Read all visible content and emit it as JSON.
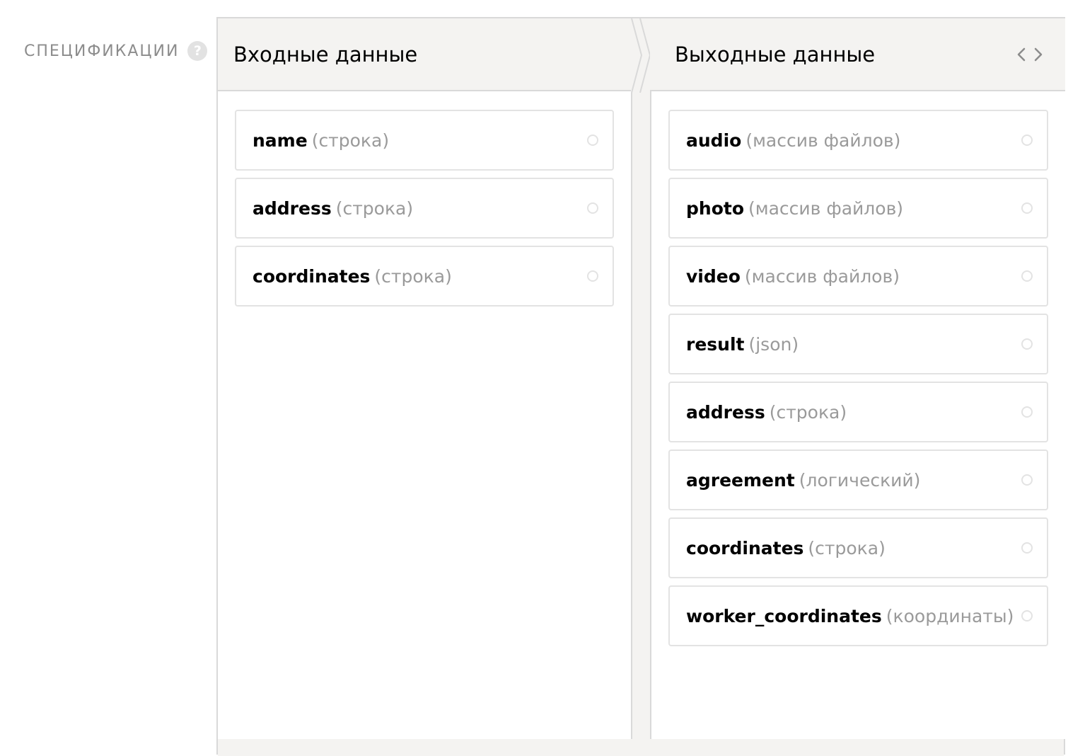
{
  "spec": {
    "label": "СПЕЦИФИКАЦИИ",
    "help_glyph": "?"
  },
  "input": {
    "title": "Входные данные",
    "fields": [
      {
        "name": "name",
        "type": "(строка)"
      },
      {
        "name": "address",
        "type": "(строка)"
      },
      {
        "name": "coordinates",
        "type": "(строка)"
      }
    ]
  },
  "output": {
    "title": "Выходные данные",
    "code_toggle_icon": "code-brackets-icon",
    "fields": [
      {
        "name": "audio",
        "type": "(массив файлов)"
      },
      {
        "name": "photo",
        "type": "(массив файлов)"
      },
      {
        "name": "video",
        "type": "(массив файлов)"
      },
      {
        "name": "result",
        "type": "(json)"
      },
      {
        "name": "address",
        "type": "(строка)"
      },
      {
        "name": "agreement",
        "type": "(логический)"
      },
      {
        "name": "coordinates",
        "type": "(строка)"
      },
      {
        "name": "worker_coordinates",
        "type": "(координаты)"
      }
    ]
  },
  "colors": {
    "panel_bg": "#f4f3f1",
    "border": "#d9d9d9",
    "type_text": "#9a9a9a",
    "label_text": "#8c8c8c"
  }
}
